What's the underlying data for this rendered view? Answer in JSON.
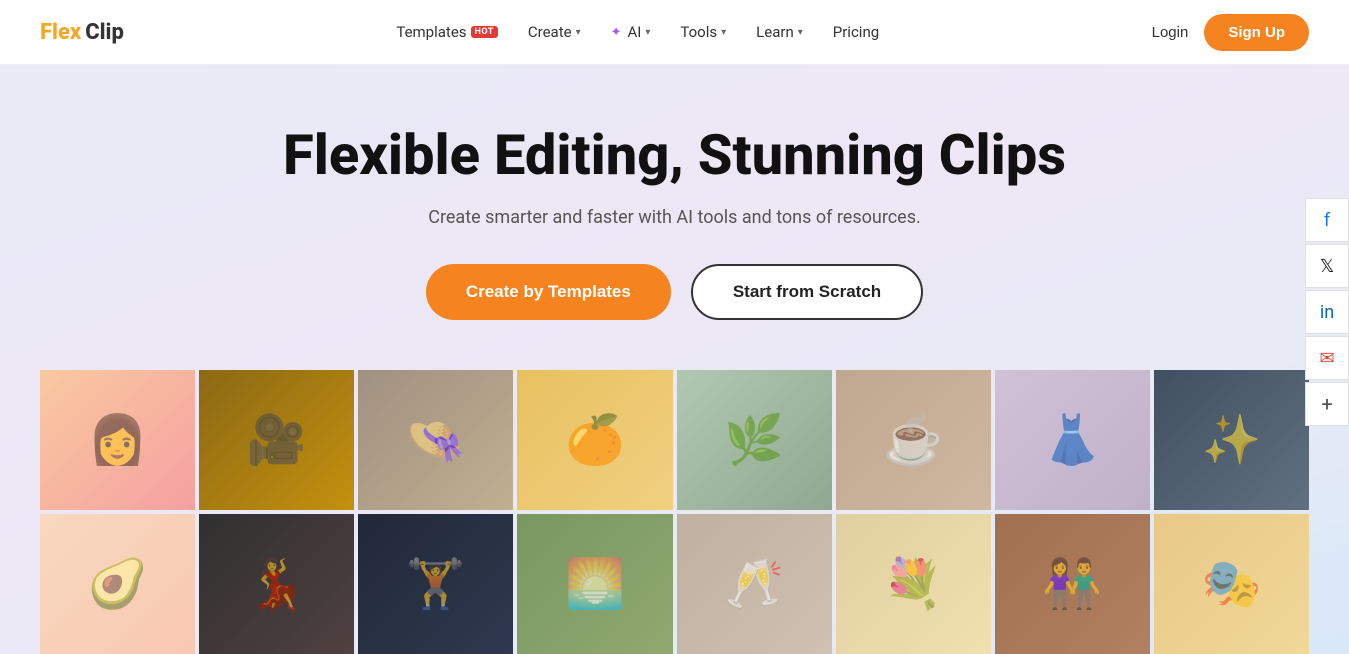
{
  "logo": {
    "flex": "Flex",
    "clip": "Clip"
  },
  "nav": {
    "templates_label": "Templates",
    "templates_hot": "HOT",
    "create_label": "Create",
    "ai_label": "AI",
    "tools_label": "Tools",
    "learn_label": "Learn",
    "pricing_label": "Pricing",
    "login_label": "Login",
    "signup_label": "Sign Up"
  },
  "hero": {
    "title": "Flexible Editing, Stunning Clips",
    "subtitle": "Create smarter and faster with AI tools and tons of resources.",
    "btn_templates": "Create by Templates",
    "btn_scratch": "Start from Scratch"
  },
  "social": {
    "facebook": "f",
    "twitter": "𝕏",
    "linkedin": "in",
    "email": "✉",
    "plus": "+"
  },
  "video_grid": {
    "row1_count": 8,
    "row2_count": 8
  }
}
